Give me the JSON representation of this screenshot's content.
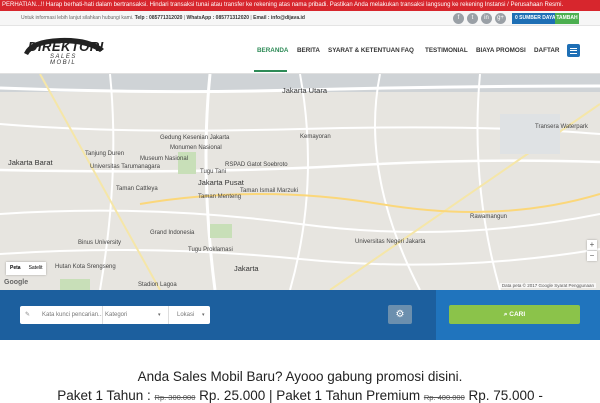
{
  "alert": "PERHATIAN...!! Harap berhati-hati dalam bertransaksi. Hindari transaksi tunai atau transfer ke rekening atas nama pribadi. Pastikan Anda melakukan transaksi langsung ke rekening Instansi / Perusahaan Resmi.",
  "infobar": {
    "intro": "Untuk informasi lebih lanjut silahkan hubungi kami.",
    "telp": "Telp : 085771312020",
    "wa": "WhatsApp : 085771312020",
    "email": "Email : info@dijava.id"
  },
  "social": [
    "f",
    "t",
    "in",
    "g+"
  ],
  "sumber_daya": "0 SUMBER DAYA",
  "tambah": "TAMBAH",
  "logo": {
    "line1": "DIREKTORI",
    "line2": "SALES MOBIL"
  },
  "nav": [
    "BERANDA",
    "BERITA",
    "SYARAT & KETENTUAN",
    "FAQ",
    "TESTIMONIAL",
    "BIAYA PROMOSI",
    "DAFTAR"
  ],
  "map": {
    "labels": [
      "Jakarta Utara",
      "Jakarta Barat",
      "Jakarta Pusat",
      "Jakarta",
      "Tanjung Duren",
      "Universitas Tarumanagara",
      "Museum Nasional",
      "Gedung Kesenian Jakarta",
      "Monumen Nasional",
      "RSPAD Gatot Soebroto",
      "Tugu Tani",
      "Taman Cattleya",
      "Taman Menteng",
      "Taman Ismail Marzuki",
      "Grand Indonesia",
      "Tugu Proklamasi",
      "Universitas Negeri Jakarta",
      "Binus University",
      "Hutan Kota Srengseng",
      "Stadion Lagoa",
      "Transera Waterpark",
      "Rawamangun",
      "Kemayoran"
    ],
    "toggle_map": "Peta",
    "toggle_sat": "Satelit",
    "google": "Google",
    "attribution": "Data peta © 2017 Google   Syarat Penggunaan"
  },
  "search": {
    "keyword_placeholder": "Kata kunci pencarian...",
    "kategori": "Kategori",
    "lokasi": "Lokasi",
    "cari": "CARI"
  },
  "promo": {
    "headline": "Anda Sales Mobil Baru? Ayooo gabung promosi disini.",
    "p1_label": "Paket 1 Tahun :",
    "p1_old": "Rp. 300.000",
    "p1_new": "Rp. 25.000",
    "sep": "|",
    "p2_label": "Paket 1 Tahun Premium",
    "p2_old": "Rp. 400.000",
    "p2_new": "Rp. 75.000 -"
  }
}
